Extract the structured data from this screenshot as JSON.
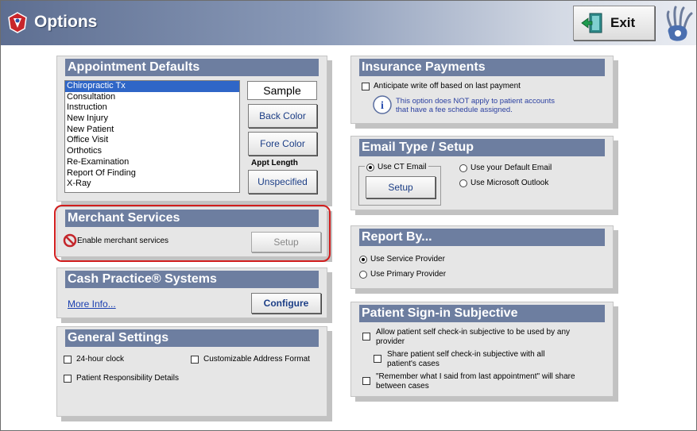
{
  "window": {
    "title": "Options",
    "exit_label": "Exit"
  },
  "appointment_defaults": {
    "title": "Appointment Defaults",
    "items": [
      "Chiropractic Tx",
      "Consultation",
      "Instruction",
      "New Injury",
      "New Patient",
      "Office Visit",
      "Orthotics",
      "Re-Examination",
      "Report Of Finding",
      "X-Ray"
    ],
    "selected_index": 0,
    "sample_label": "Sample",
    "back_color_label": "Back Color",
    "fore_color_label": "Fore Color",
    "appt_length_label": "Appt Length",
    "appt_length_value": "Unspecified"
  },
  "merchant_services": {
    "title": "Merchant Services",
    "enable_label": "Enable merchant services",
    "setup_label": "Setup"
  },
  "cash_practice": {
    "title": "Cash Practice® Systems",
    "more_info": "More Info...",
    "configure_label": "Configure"
  },
  "general_settings": {
    "title": "General Settings",
    "clock_label": "24-hour clock",
    "address_label": "Customizable Address Format",
    "responsibility_label": "Patient Responsibility Details"
  },
  "insurance_payments": {
    "title": "Insurance Payments",
    "anticipate_label": "Anticipate write off based on last payment",
    "info_line1": "This option does NOT apply to patient accounts",
    "info_line2": "that have a fee schedule assigned."
  },
  "email_setup": {
    "title": "Email Type / Setup",
    "ct_email_label": "Use CT Email",
    "setup_label": "Setup",
    "default_email_label": "Use your Default Email",
    "outlook_label": "Use Microsoft Outlook",
    "selected": "Use CT Email"
  },
  "report_by": {
    "title": "Report By...",
    "service_label": "Use Service Provider",
    "primary_label": "Use Primary Provider",
    "selected": "Use Service Provider"
  },
  "patient_signin": {
    "title": "Patient Sign-in Subjective",
    "allow_line1": "Allow patient self check-in subjective to be used by any",
    "allow_line2": "provider",
    "share_line1": "Share patient self check-in subjective with all",
    "share_line2": "patient's cases",
    "remember_line1": "\"Remember what I said from last appointment\" will share",
    "remember_line2": "between cases"
  },
  "colors": {
    "header": "#6d7ea0",
    "panel": "#e6e6e6",
    "highlight": "#d11d1d",
    "selection": "#2f66c7"
  }
}
